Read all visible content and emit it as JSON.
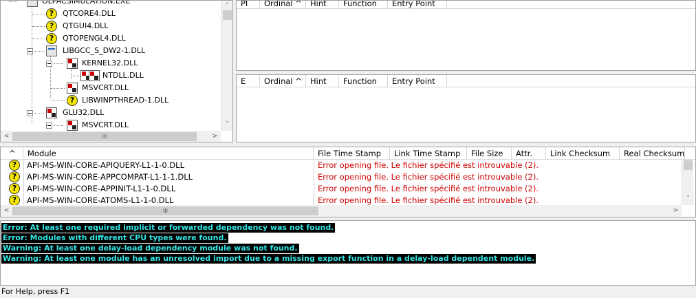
{
  "tree": {
    "nodes": [
      {
        "label": "OLPACSIMULATION.EXE",
        "icon": "exe-icon"
      },
      {
        "label": "QTCORE4.DLL",
        "icon": "missing-module-icon"
      },
      {
        "label": "QTGUI4.DLL",
        "icon": "missing-module-icon"
      },
      {
        "label": "QTOPENGL4.DLL",
        "icon": "missing-module-icon"
      },
      {
        "label": "LIBGCC_S_DW2-1.DLL",
        "icon": "dll-icon"
      },
      {
        "label": "KERNEL32.DLL",
        "icon": "system-dll-icon"
      },
      {
        "label": "NTDLL.DLL",
        "icon": "system-dll-icon"
      },
      {
        "label": "MSVCRT.DLL",
        "icon": "system-dll-icon"
      },
      {
        "label": "LIBWINPTHREAD-1.DLL",
        "icon": "missing-module-icon"
      },
      {
        "label": "GLU32.DLL",
        "icon": "system-dll-icon"
      },
      {
        "label": "MSVCRT.DLL",
        "icon": "system-dll-icon"
      }
    ]
  },
  "imports": {
    "columns": [
      "PI",
      "Ordinal ^",
      "Hint",
      "Function",
      "Entry Point"
    ]
  },
  "exports": {
    "columns": [
      "E",
      "Ordinal ^",
      "Hint",
      "Function",
      "Entry Point"
    ]
  },
  "modules": {
    "columns": [
      "^",
      "Module",
      "File Time Stamp",
      "Link Time Stamp",
      "File Size",
      "Attr.",
      "Link Checksum",
      "Real Checksum"
    ],
    "rows": [
      {
        "name": "API-MS-WIN-CORE-APIQUERY-L1-1-0.DLL",
        "error": "Error opening file. Le fichier spécifié est introuvable (2)."
      },
      {
        "name": "API-MS-WIN-CORE-APPCOMPAT-L1-1-1.DLL",
        "error": "Error opening file. Le fichier spécifié est introuvable (2)."
      },
      {
        "name": "API-MS-WIN-CORE-APPINIT-L1-1-0.DLL",
        "error": "Error opening file. Le fichier spécifié est introuvable (2)."
      },
      {
        "name": "API-MS-WIN-CORE-ATOMS-L1-1-0.DLL",
        "error": "Error opening file. Le fichier spécifié est introuvable (2)."
      }
    ]
  },
  "log": {
    "lines": [
      "Error: At least one required implicit or forwarded dependency was not found.",
      "Error: Modules with different CPU types were found.",
      "Warning: At least one delay-load dependency module was not found.",
      "Warning: At least one module has an unresolved import due to a missing export function in a delay-load dependent module."
    ]
  },
  "status": {
    "text": "For Help, press F1"
  },
  "scroll": {
    "up": "˄",
    "down": "˅",
    "left": "<",
    "right": ">",
    "grip": "III"
  },
  "colors": {
    "error_text": "#d00000",
    "log_text": "#35e6e6",
    "log_bg": "#000000"
  }
}
